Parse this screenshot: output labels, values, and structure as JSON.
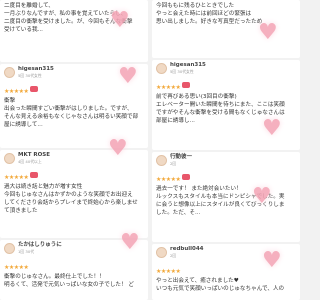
{
  "left": {
    "r1": {
      "text": [
        "二度目を離婚して、",
        "一月ぶりなんですが、私の事を覚えていたらし、",
        "二度目の衝撃を受けました。が、今回もそんな衝撃",
        "受けている我..."
      ]
    },
    "r2": {
      "user": "higesan315",
      "meta": "5回 30代女性",
      "stars": "★★★★★",
      "text": [
        "衝撃",
        "出会った瞬間すごい衝撃がはしりました。ですが、",
        "そんな見える余裕もなくじゃなさんは明るい笑顔で部",
        "屋に誘導して..."
      ]
    },
    "r3": {
      "user": "MKT ROSE",
      "meta": "4回 40代以上",
      "stars": "★★★★★",
      "text": [
        "過大は続き話と魅力が増す女性",
        "今回もじゅなさんはかずかのような笑顔でお出迎え",
        "してくださり会話からプレイまで終始心から楽しませ",
        "て頂きました"
      ]
    },
    "r4": {
      "user": "たかはしりゅうに",
      "meta": "1回 30代",
      "stars": "★★★★★",
      "text": [
        "衝撃のじゅなさん。最終仕上でした！！",
        "明るくて、活発で元気いっぱいな女の子でした！ ど"
      ]
    }
  },
  "right": {
    "r1": {
      "text": [
        "今回ももに残るひとときでした",
        "やっと会えた時には前回ほどの緊張は",
        "思い出しました。好きな写真型だったため"
      ]
    },
    "r2": {
      "user": "higesan315",
      "meta": "5回 30代女性",
      "stars": "★★★★★",
      "text": [
        "前で再びある思い(3回目の衝撃)",
        "エレベーター開いた瞬間を待ちにまた、ここは笑顔",
        "ですがやそんな衝撃を受ける間もなくじゅなさんは",
        "部屋に誘導し..."
      ]
    },
    "r3": {
      "user": "行動彼一",
      "meta": "2回",
      "stars": "★★★★★",
      "text": [
        "過去一です！ また絶対会いたい！",
        "ルックスもスタイルも本当にドンピシャでした。実",
        "に会うと想像以上にスタイルが良くてびっくりしま",
        "した。ただ、そ..."
      ]
    },
    "r4": {
      "user": "redbull044",
      "meta": "2回",
      "stars": "★★★★★",
      "text": [
        "やっと出会えて、癒されました♥",
        "いつも元気で笑顔いっぱいのじゅなちゃんで、人の"
      ]
    }
  },
  "colors": {
    "star": "#f2a93b",
    "badge": "#e8566a",
    "heart": "#f4a3b4",
    "highlight": "#fff3a0"
  }
}
